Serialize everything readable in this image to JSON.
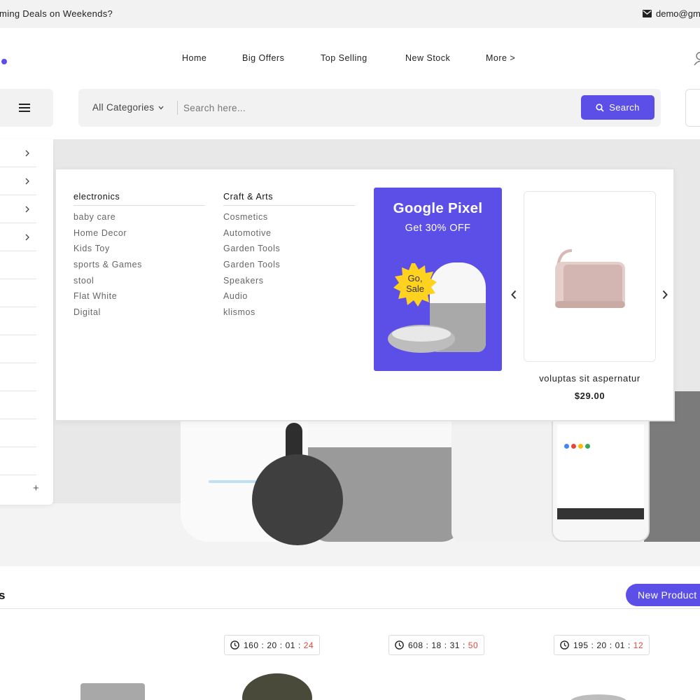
{
  "topbar": {
    "promo_text": "ming Deals on Weekends?",
    "email_text": "demo@gm"
  },
  "nav": {
    "items": [
      "Home",
      "Big Offers",
      "Top Selling",
      "New Stock",
      "More >"
    ]
  },
  "search": {
    "category_label": "All Categories",
    "placeholder": "Search here...",
    "button_label": "Search"
  },
  "mega_menu": {
    "columns": [
      {
        "heading": "electronics",
        "items": [
          "baby care",
          "Home Decor",
          "Kids Toy",
          "sports & Games",
          "stool",
          "Flat White",
          "Digital"
        ]
      },
      {
        "heading": "Craft & Arts",
        "items": [
          "Cosmetics",
          "Automotive",
          "Garden Tools",
          "Garden Tools",
          "Speakers",
          "Audio",
          "klismos"
        ]
      }
    ],
    "promo": {
      "title": "Google Pixel",
      "subtitle": "Get 30% OFF",
      "badge_line1": "Go,",
      "badge_line2": "Sale"
    },
    "product": {
      "name": "voluptas sit aspernatur",
      "price": "$29.00"
    }
  },
  "sidebar": {
    "expand_symbol": "+"
  },
  "products_section": {
    "title": "s",
    "new_products_button": "New Product",
    "timers": [
      {
        "days": "160",
        "hours": "20",
        "minutes": "01",
        "seconds": "24"
      },
      {
        "days": "608",
        "hours": "18",
        "minutes": "31",
        "seconds": "50"
      },
      {
        "days": "195",
        "hours": "20",
        "minutes": "01",
        "seconds": "12"
      }
    ]
  },
  "colors": {
    "accent": "#5b4fe8",
    "countdown_seconds": "#e0473e",
    "topbar_bg": "#f2f2f2"
  },
  "icons": [
    "mail-icon",
    "user-icon",
    "hamburger-icon",
    "chevron-down-icon",
    "search-icon",
    "chevron-right-icon",
    "plus-icon",
    "clock-icon"
  ]
}
